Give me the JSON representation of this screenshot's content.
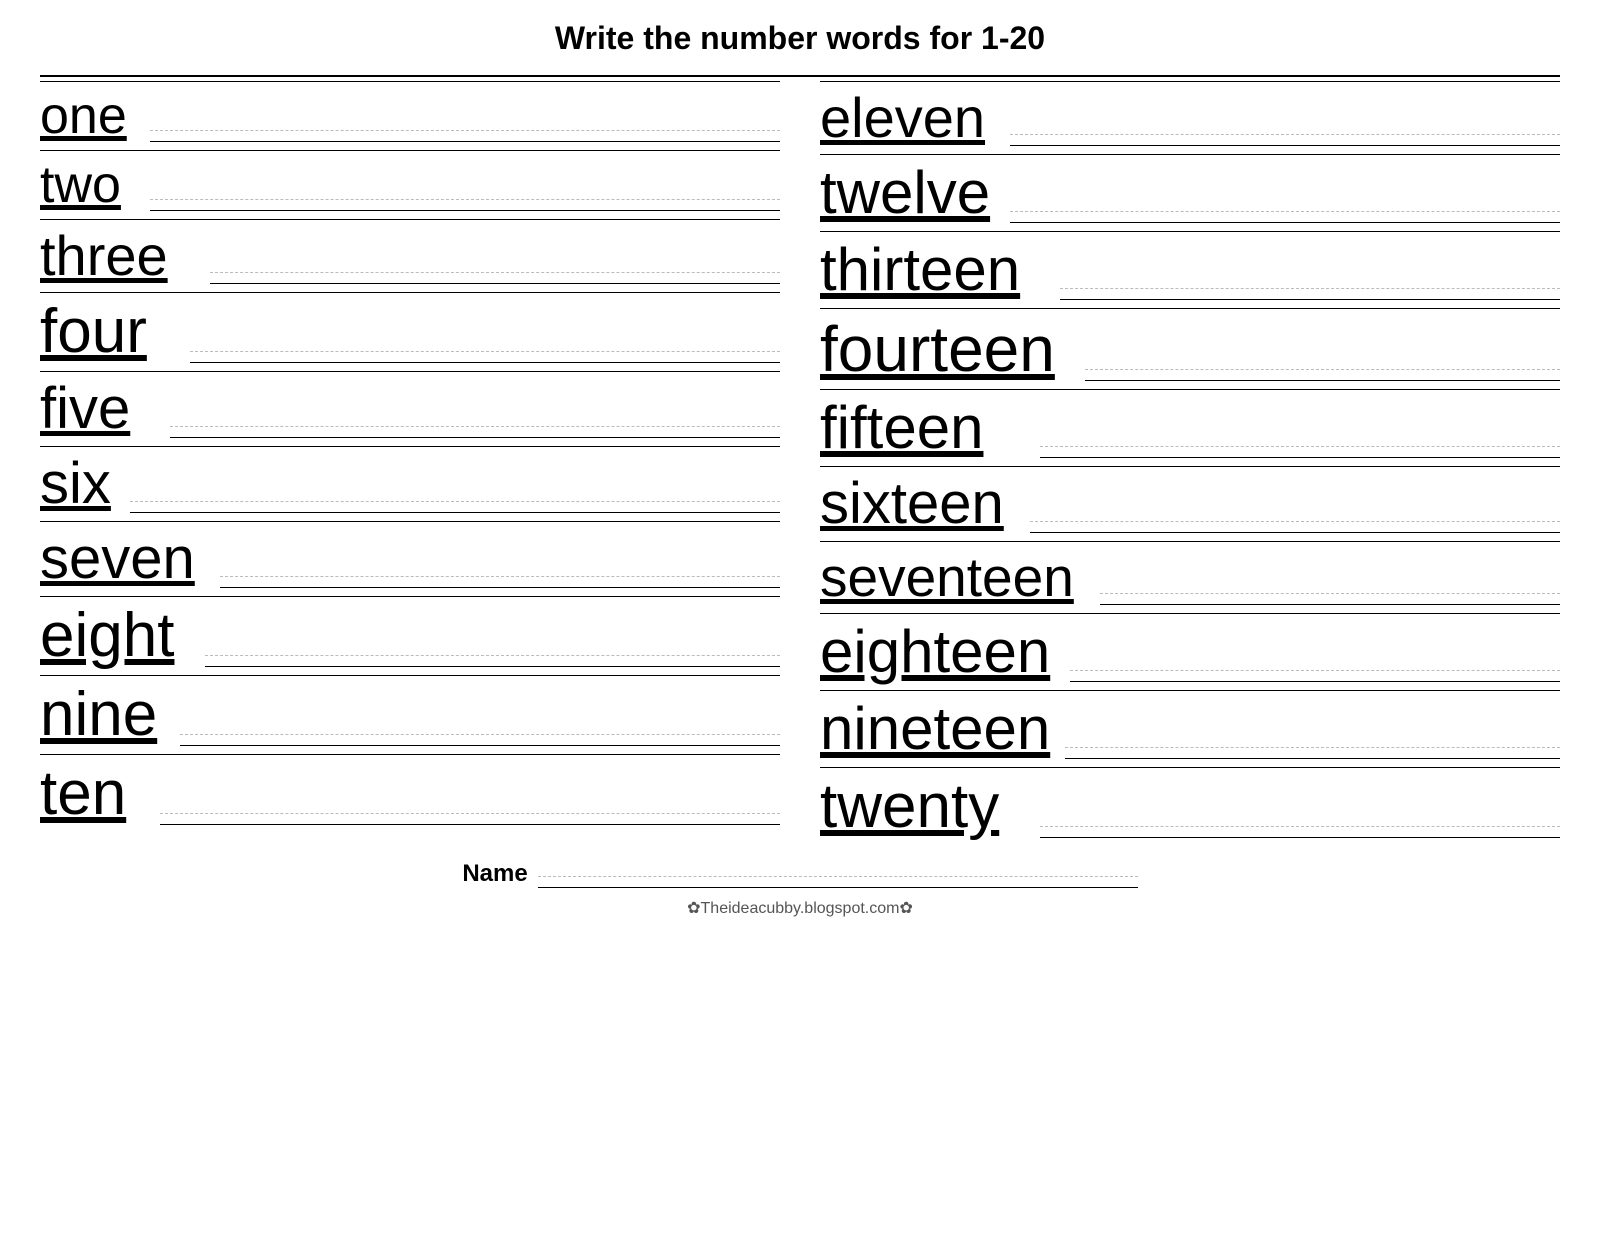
{
  "title": "Write the number words for  1-20",
  "left_words": [
    {
      "word": "one",
      "class": "word-one"
    },
    {
      "word": "two",
      "class": "word-two"
    },
    {
      "word": "three",
      "class": "word-three"
    },
    {
      "word": "four",
      "class": "word-four"
    },
    {
      "word": "five",
      "class": "word-five"
    },
    {
      "word": "six",
      "class": "word-six"
    },
    {
      "word": "seven",
      "class": "word-seven"
    },
    {
      "word": "eight",
      "class": "word-eight"
    },
    {
      "word": "nine",
      "class": "word-nine"
    },
    {
      "word": "ten",
      "class": "word-ten"
    }
  ],
  "right_words": [
    {
      "word": "eleven",
      "class": "word-eleven"
    },
    {
      "word": "twelve",
      "class": "word-twelve"
    },
    {
      "word": "thirteen",
      "class": "word-thirteen"
    },
    {
      "word": "fourteen",
      "class": "word-fourteen"
    },
    {
      "word": "fifteen",
      "class": "word-fifteen"
    },
    {
      "word": "sixteen",
      "class": "word-sixteen"
    },
    {
      "word": "seventeen",
      "class": "word-seventeen"
    },
    {
      "word": "eighteen",
      "class": "word-eighteen"
    },
    {
      "word": "nineteen",
      "class": "word-nineteen"
    },
    {
      "word": "twenty",
      "class": "word-twenty"
    }
  ],
  "name_label": "Name",
  "footer": "✿Theideacubby.blogspot.com✿"
}
